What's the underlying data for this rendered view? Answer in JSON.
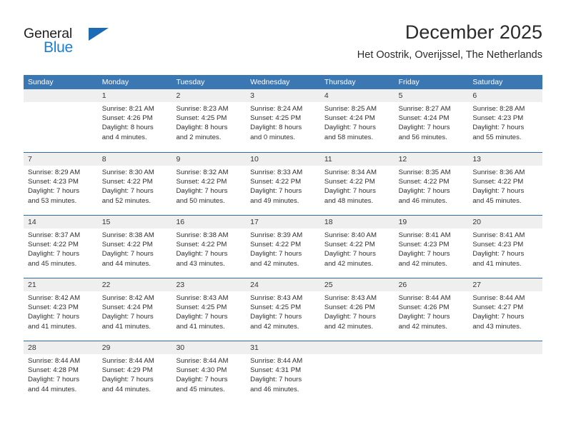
{
  "brand": {
    "name_part1": "General",
    "name_part2": "Blue",
    "triangle_color": "#1b6cb5",
    "blue_text_color": "#1a7fd4"
  },
  "header": {
    "title": "December 2025",
    "subtitle": "Het Oostrik, Overijssel, The Netherlands"
  },
  "theme": {
    "header_row_bg": "#3b77b3",
    "row_divider": "#2f6ca8",
    "daynum_band_bg": "#efefef",
    "text_color": "#2e2e2e"
  },
  "weekdays": [
    "Sunday",
    "Monday",
    "Tuesday",
    "Wednesday",
    "Thursday",
    "Friday",
    "Saturday"
  ],
  "weeks": [
    [
      {
        "day": "",
        "lines": [
          "",
          "",
          "",
          ""
        ]
      },
      {
        "day": "1",
        "lines": [
          "Sunrise: 8:21 AM",
          "Sunset: 4:26 PM",
          "Daylight: 8 hours",
          "and 4 minutes."
        ]
      },
      {
        "day": "2",
        "lines": [
          "Sunrise: 8:23 AM",
          "Sunset: 4:25 PM",
          "Daylight: 8 hours",
          "and 2 minutes."
        ]
      },
      {
        "day": "3",
        "lines": [
          "Sunrise: 8:24 AM",
          "Sunset: 4:25 PM",
          "Daylight: 8 hours",
          "and 0 minutes."
        ]
      },
      {
        "day": "4",
        "lines": [
          "Sunrise: 8:25 AM",
          "Sunset: 4:24 PM",
          "Daylight: 7 hours",
          "and 58 minutes."
        ]
      },
      {
        "day": "5",
        "lines": [
          "Sunrise: 8:27 AM",
          "Sunset: 4:24 PM",
          "Daylight: 7 hours",
          "and 56 minutes."
        ]
      },
      {
        "day": "6",
        "lines": [
          "Sunrise: 8:28 AM",
          "Sunset: 4:23 PM",
          "Daylight: 7 hours",
          "and 55 minutes."
        ]
      }
    ],
    [
      {
        "day": "7",
        "lines": [
          "Sunrise: 8:29 AM",
          "Sunset: 4:23 PM",
          "Daylight: 7 hours",
          "and 53 minutes."
        ]
      },
      {
        "day": "8",
        "lines": [
          "Sunrise: 8:30 AM",
          "Sunset: 4:22 PM",
          "Daylight: 7 hours",
          "and 52 minutes."
        ]
      },
      {
        "day": "9",
        "lines": [
          "Sunrise: 8:32 AM",
          "Sunset: 4:22 PM",
          "Daylight: 7 hours",
          "and 50 minutes."
        ]
      },
      {
        "day": "10",
        "lines": [
          "Sunrise: 8:33 AM",
          "Sunset: 4:22 PM",
          "Daylight: 7 hours",
          "and 49 minutes."
        ]
      },
      {
        "day": "11",
        "lines": [
          "Sunrise: 8:34 AM",
          "Sunset: 4:22 PM",
          "Daylight: 7 hours",
          "and 48 minutes."
        ]
      },
      {
        "day": "12",
        "lines": [
          "Sunrise: 8:35 AM",
          "Sunset: 4:22 PM",
          "Daylight: 7 hours",
          "and 46 minutes."
        ]
      },
      {
        "day": "13",
        "lines": [
          "Sunrise: 8:36 AM",
          "Sunset: 4:22 PM",
          "Daylight: 7 hours",
          "and 45 minutes."
        ]
      }
    ],
    [
      {
        "day": "14",
        "lines": [
          "Sunrise: 8:37 AM",
          "Sunset: 4:22 PM",
          "Daylight: 7 hours",
          "and 45 minutes."
        ]
      },
      {
        "day": "15",
        "lines": [
          "Sunrise: 8:38 AM",
          "Sunset: 4:22 PM",
          "Daylight: 7 hours",
          "and 44 minutes."
        ]
      },
      {
        "day": "16",
        "lines": [
          "Sunrise: 8:38 AM",
          "Sunset: 4:22 PM",
          "Daylight: 7 hours",
          "and 43 minutes."
        ]
      },
      {
        "day": "17",
        "lines": [
          "Sunrise: 8:39 AM",
          "Sunset: 4:22 PM",
          "Daylight: 7 hours",
          "and 42 minutes."
        ]
      },
      {
        "day": "18",
        "lines": [
          "Sunrise: 8:40 AM",
          "Sunset: 4:22 PM",
          "Daylight: 7 hours",
          "and 42 minutes."
        ]
      },
      {
        "day": "19",
        "lines": [
          "Sunrise: 8:41 AM",
          "Sunset: 4:23 PM",
          "Daylight: 7 hours",
          "and 42 minutes."
        ]
      },
      {
        "day": "20",
        "lines": [
          "Sunrise: 8:41 AM",
          "Sunset: 4:23 PM",
          "Daylight: 7 hours",
          "and 41 minutes."
        ]
      }
    ],
    [
      {
        "day": "21",
        "lines": [
          "Sunrise: 8:42 AM",
          "Sunset: 4:23 PM",
          "Daylight: 7 hours",
          "and 41 minutes."
        ]
      },
      {
        "day": "22",
        "lines": [
          "Sunrise: 8:42 AM",
          "Sunset: 4:24 PM",
          "Daylight: 7 hours",
          "and 41 minutes."
        ]
      },
      {
        "day": "23",
        "lines": [
          "Sunrise: 8:43 AM",
          "Sunset: 4:25 PM",
          "Daylight: 7 hours",
          "and 41 minutes."
        ]
      },
      {
        "day": "24",
        "lines": [
          "Sunrise: 8:43 AM",
          "Sunset: 4:25 PM",
          "Daylight: 7 hours",
          "and 42 minutes."
        ]
      },
      {
        "day": "25",
        "lines": [
          "Sunrise: 8:43 AM",
          "Sunset: 4:26 PM",
          "Daylight: 7 hours",
          "and 42 minutes."
        ]
      },
      {
        "day": "26",
        "lines": [
          "Sunrise: 8:44 AM",
          "Sunset: 4:26 PM",
          "Daylight: 7 hours",
          "and 42 minutes."
        ]
      },
      {
        "day": "27",
        "lines": [
          "Sunrise: 8:44 AM",
          "Sunset: 4:27 PM",
          "Daylight: 7 hours",
          "and 43 minutes."
        ]
      }
    ],
    [
      {
        "day": "28",
        "lines": [
          "Sunrise: 8:44 AM",
          "Sunset: 4:28 PM",
          "Daylight: 7 hours",
          "and 44 minutes."
        ]
      },
      {
        "day": "29",
        "lines": [
          "Sunrise: 8:44 AM",
          "Sunset: 4:29 PM",
          "Daylight: 7 hours",
          "and 44 minutes."
        ]
      },
      {
        "day": "30",
        "lines": [
          "Sunrise: 8:44 AM",
          "Sunset: 4:30 PM",
          "Daylight: 7 hours",
          "and 45 minutes."
        ]
      },
      {
        "day": "31",
        "lines": [
          "Sunrise: 8:44 AM",
          "Sunset: 4:31 PM",
          "Daylight: 7 hours",
          "and 46 minutes."
        ]
      },
      {
        "day": "",
        "lines": [
          "",
          "",
          "",
          ""
        ]
      },
      {
        "day": "",
        "lines": [
          "",
          "",
          "",
          ""
        ]
      },
      {
        "day": "",
        "lines": [
          "",
          "",
          "",
          ""
        ]
      }
    ]
  ]
}
